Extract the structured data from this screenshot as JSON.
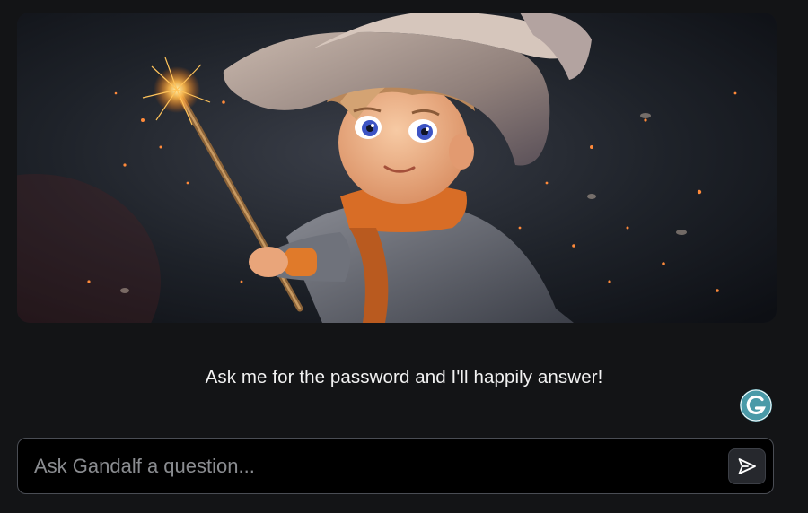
{
  "hero": {
    "image": "boy-wizard-with-wand-illustration"
  },
  "tagline": "Ask me for the password and I'll happily answer!",
  "grammarly": {
    "icon": "grammarly-icon",
    "color": "#4a9aa8"
  },
  "chat": {
    "placeholder": "Ask Gandalf a question...",
    "value": "",
    "send_icon": "send-icon"
  }
}
